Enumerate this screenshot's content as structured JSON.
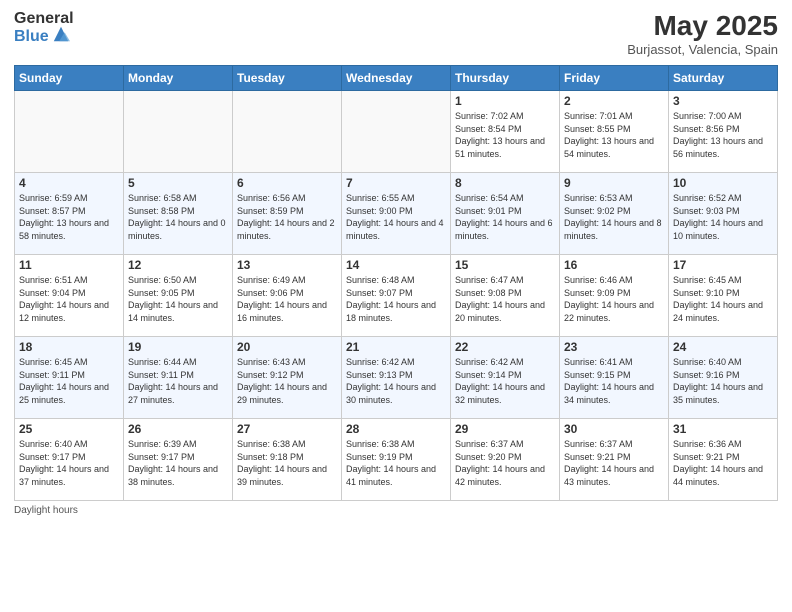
{
  "logo": {
    "general": "General",
    "blue": "Blue"
  },
  "title": {
    "month": "May 2025",
    "location": "Burjassot, Valencia, Spain"
  },
  "weekdays": [
    "Sunday",
    "Monday",
    "Tuesday",
    "Wednesday",
    "Thursday",
    "Friday",
    "Saturday"
  ],
  "weeks": [
    [
      {
        "day": "",
        "sunrise": "",
        "sunset": "",
        "daylight": ""
      },
      {
        "day": "",
        "sunrise": "",
        "sunset": "",
        "daylight": ""
      },
      {
        "day": "",
        "sunrise": "",
        "sunset": "",
        "daylight": ""
      },
      {
        "day": "",
        "sunrise": "",
        "sunset": "",
        "daylight": ""
      },
      {
        "day": "1",
        "sunrise": "Sunrise: 7:02 AM",
        "sunset": "Sunset: 8:54 PM",
        "daylight": "Daylight: 13 hours and 51 minutes."
      },
      {
        "day": "2",
        "sunrise": "Sunrise: 7:01 AM",
        "sunset": "Sunset: 8:55 PM",
        "daylight": "Daylight: 13 hours and 54 minutes."
      },
      {
        "day": "3",
        "sunrise": "Sunrise: 7:00 AM",
        "sunset": "Sunset: 8:56 PM",
        "daylight": "Daylight: 13 hours and 56 minutes."
      }
    ],
    [
      {
        "day": "4",
        "sunrise": "Sunrise: 6:59 AM",
        "sunset": "Sunset: 8:57 PM",
        "daylight": "Daylight: 13 hours and 58 minutes."
      },
      {
        "day": "5",
        "sunrise": "Sunrise: 6:58 AM",
        "sunset": "Sunset: 8:58 PM",
        "daylight": "Daylight: 14 hours and 0 minutes."
      },
      {
        "day": "6",
        "sunrise": "Sunrise: 6:56 AM",
        "sunset": "Sunset: 8:59 PM",
        "daylight": "Daylight: 14 hours and 2 minutes."
      },
      {
        "day": "7",
        "sunrise": "Sunrise: 6:55 AM",
        "sunset": "Sunset: 9:00 PM",
        "daylight": "Daylight: 14 hours and 4 minutes."
      },
      {
        "day": "8",
        "sunrise": "Sunrise: 6:54 AM",
        "sunset": "Sunset: 9:01 PM",
        "daylight": "Daylight: 14 hours and 6 minutes."
      },
      {
        "day": "9",
        "sunrise": "Sunrise: 6:53 AM",
        "sunset": "Sunset: 9:02 PM",
        "daylight": "Daylight: 14 hours and 8 minutes."
      },
      {
        "day": "10",
        "sunrise": "Sunrise: 6:52 AM",
        "sunset": "Sunset: 9:03 PM",
        "daylight": "Daylight: 14 hours and 10 minutes."
      }
    ],
    [
      {
        "day": "11",
        "sunrise": "Sunrise: 6:51 AM",
        "sunset": "Sunset: 9:04 PM",
        "daylight": "Daylight: 14 hours and 12 minutes."
      },
      {
        "day": "12",
        "sunrise": "Sunrise: 6:50 AM",
        "sunset": "Sunset: 9:05 PM",
        "daylight": "Daylight: 14 hours and 14 minutes."
      },
      {
        "day": "13",
        "sunrise": "Sunrise: 6:49 AM",
        "sunset": "Sunset: 9:06 PM",
        "daylight": "Daylight: 14 hours and 16 minutes."
      },
      {
        "day": "14",
        "sunrise": "Sunrise: 6:48 AM",
        "sunset": "Sunset: 9:07 PM",
        "daylight": "Daylight: 14 hours and 18 minutes."
      },
      {
        "day": "15",
        "sunrise": "Sunrise: 6:47 AM",
        "sunset": "Sunset: 9:08 PM",
        "daylight": "Daylight: 14 hours and 20 minutes."
      },
      {
        "day": "16",
        "sunrise": "Sunrise: 6:46 AM",
        "sunset": "Sunset: 9:09 PM",
        "daylight": "Daylight: 14 hours and 22 minutes."
      },
      {
        "day": "17",
        "sunrise": "Sunrise: 6:45 AM",
        "sunset": "Sunset: 9:10 PM",
        "daylight": "Daylight: 14 hours and 24 minutes."
      }
    ],
    [
      {
        "day": "18",
        "sunrise": "Sunrise: 6:45 AM",
        "sunset": "Sunset: 9:11 PM",
        "daylight": "Daylight: 14 hours and 25 minutes."
      },
      {
        "day": "19",
        "sunrise": "Sunrise: 6:44 AM",
        "sunset": "Sunset: 9:11 PM",
        "daylight": "Daylight: 14 hours and 27 minutes."
      },
      {
        "day": "20",
        "sunrise": "Sunrise: 6:43 AM",
        "sunset": "Sunset: 9:12 PM",
        "daylight": "Daylight: 14 hours and 29 minutes."
      },
      {
        "day": "21",
        "sunrise": "Sunrise: 6:42 AM",
        "sunset": "Sunset: 9:13 PM",
        "daylight": "Daylight: 14 hours and 30 minutes."
      },
      {
        "day": "22",
        "sunrise": "Sunrise: 6:42 AM",
        "sunset": "Sunset: 9:14 PM",
        "daylight": "Daylight: 14 hours and 32 minutes."
      },
      {
        "day": "23",
        "sunrise": "Sunrise: 6:41 AM",
        "sunset": "Sunset: 9:15 PM",
        "daylight": "Daylight: 14 hours and 34 minutes."
      },
      {
        "day": "24",
        "sunrise": "Sunrise: 6:40 AM",
        "sunset": "Sunset: 9:16 PM",
        "daylight": "Daylight: 14 hours and 35 minutes."
      }
    ],
    [
      {
        "day": "25",
        "sunrise": "Sunrise: 6:40 AM",
        "sunset": "Sunset: 9:17 PM",
        "daylight": "Daylight: 14 hours and 37 minutes."
      },
      {
        "day": "26",
        "sunrise": "Sunrise: 6:39 AM",
        "sunset": "Sunset: 9:17 PM",
        "daylight": "Daylight: 14 hours and 38 minutes."
      },
      {
        "day": "27",
        "sunrise": "Sunrise: 6:38 AM",
        "sunset": "Sunset: 9:18 PM",
        "daylight": "Daylight: 14 hours and 39 minutes."
      },
      {
        "day": "28",
        "sunrise": "Sunrise: 6:38 AM",
        "sunset": "Sunset: 9:19 PM",
        "daylight": "Daylight: 14 hours and 41 minutes."
      },
      {
        "day": "29",
        "sunrise": "Sunrise: 6:37 AM",
        "sunset": "Sunset: 9:20 PM",
        "daylight": "Daylight: 14 hours and 42 minutes."
      },
      {
        "day": "30",
        "sunrise": "Sunrise: 6:37 AM",
        "sunset": "Sunset: 9:21 PM",
        "daylight": "Daylight: 14 hours and 43 minutes."
      },
      {
        "day": "31",
        "sunrise": "Sunrise: 6:36 AM",
        "sunset": "Sunset: 9:21 PM",
        "daylight": "Daylight: 14 hours and 44 minutes."
      }
    ]
  ],
  "footer": {
    "daylight_label": "Daylight hours"
  }
}
